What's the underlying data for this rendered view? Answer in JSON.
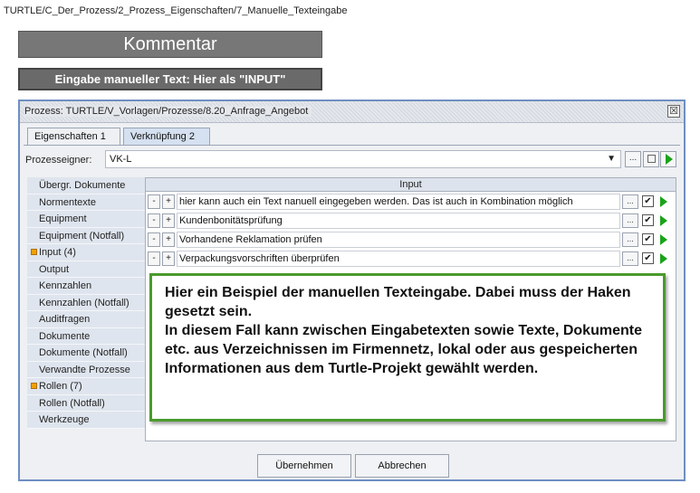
{
  "breadcrumb": "TURTLE/C_Der_Prozess/2_Prozess_Eigenschaften/7_Manuelle_Texteingabe",
  "banners": {
    "title": "Kommentar",
    "subtitle": "Eingabe manueller Text: Hier als \"INPUT\""
  },
  "window": {
    "title": "Prozess: TURTLE/V_Vorlagen/Prozesse/8.20_Anfrage_Angebot",
    "close_glyph": "☒",
    "tabs": [
      {
        "label": "Eigenschaften 1",
        "active": false
      },
      {
        "label": "Verknüpfung 2",
        "active": true
      }
    ],
    "owner": {
      "label": "Prozesseigner:",
      "value": "VK-L"
    }
  },
  "sidebar": {
    "items": [
      {
        "label": "Übergr. Dokumente",
        "marked": false
      },
      {
        "label": "Normentexte",
        "marked": false
      },
      {
        "label": "Equipment",
        "marked": false
      },
      {
        "label": "Equipment (Notfall)",
        "marked": false
      },
      {
        "label": "Input (4)",
        "marked": true
      },
      {
        "label": "Output",
        "marked": false
      },
      {
        "label": "Kennzahlen",
        "marked": false
      },
      {
        "label": "Kennzahlen (Notfall)",
        "marked": false
      },
      {
        "label": "Auditfragen",
        "marked": false
      },
      {
        "label": "Dokumente",
        "marked": false
      },
      {
        "label": "Dokumente (Notfall)",
        "marked": false
      },
      {
        "label": "Verwandte Prozesse",
        "marked": false
      },
      {
        "label": "Rollen (7)",
        "marked": true
      },
      {
        "label": "Rollen (Notfall)",
        "marked": false
      },
      {
        "label": "Werkzeuge",
        "marked": false
      }
    ]
  },
  "input_panel": {
    "header": "Input",
    "minus": "-",
    "plus": "+",
    "dots": "...",
    "check": "✔",
    "rows": [
      {
        "text": "hier kann auch ein Text nanuell eingegeben werden. Das ist auch in Kombination möglich",
        "checked": true
      },
      {
        "text": "Kundenbonitätsprüfung",
        "checked": true
      },
      {
        "text": "Vorhandene Reklamation prüfen",
        "checked": true
      },
      {
        "text": "Verpackungsvorschriften überprüfen",
        "checked": true
      }
    ]
  },
  "note": {
    "line1": "Hier ein Beispiel der manuellen Texteingabe. Dabei muss der Haken gesetzt sein.",
    "line2": "In diesem Fall kann zwischen Eingabetexten sowie Texte, Dokumente etc. aus Verzeichnissen im Firmennetz, lokal oder aus gespeicherten Informationen aus dem Turtle-Projekt gewählt werden."
  },
  "footer": {
    "ok_label": "Übernehmen",
    "cancel_label": "Abbrechen"
  },
  "colors": {
    "banner": "#777777",
    "window_border": "#6e8fc2",
    "note_border": "#4a9a2d",
    "play_icon": "#1aa31a",
    "marker": "#f0a000"
  }
}
